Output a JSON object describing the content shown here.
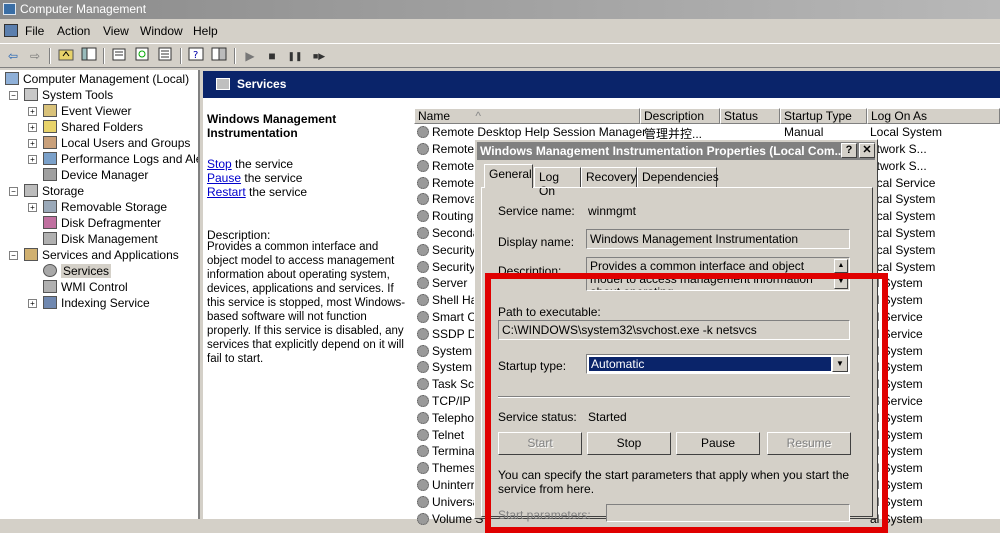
{
  "window": {
    "title": "Computer Management"
  },
  "menu": {
    "items": [
      "File",
      "Action",
      "View",
      "Window",
      "Help"
    ]
  },
  "toolbar": {
    "icons": [
      "back-arrow-icon",
      "forward-arrow-icon",
      "up-folder-icon",
      "show-hide-tree-icon",
      "properties-icon",
      "refresh-icon",
      "export-list-icon",
      "help-icon",
      "description-toggle-icon",
      "play-icon",
      "stop-icon",
      "pause-icon",
      "restart-icon"
    ],
    "glyphs": {
      "back": "⇦",
      "forward": "⇨",
      "play": "▶",
      "stop": "■",
      "pause": "❚❚",
      "restart": "■▶"
    }
  },
  "tree": {
    "root": "Computer Management (Local)",
    "system_tools": "System Tools",
    "event_viewer": "Event Viewer",
    "shared_folders": "Shared Folders",
    "local_users": "Local Users and Groups",
    "perf_logs": "Performance Logs and Alerts",
    "device_manager": "Device Manager",
    "storage": "Storage",
    "removable_storage": "Removable Storage",
    "disk_defrag": "Disk Defragmenter",
    "disk_mgmt": "Disk Management",
    "services_apps": "Services and Applications",
    "services": "Services",
    "wmi_control": "WMI Control",
    "indexing": "Indexing Service",
    "expand_minus": "−",
    "expand_plus": "+"
  },
  "services_header": {
    "title": "Services"
  },
  "description_pane": {
    "title": "Windows Management Instrumentation",
    "stop_link": "Stop",
    "stop_rest": " the service",
    "pause_link": "Pause",
    "pause_rest": " the service",
    "restart_link": "Restart",
    "restart_rest": " the service",
    "desc_label": "Description:",
    "desc_text": "Provides a common interface and object model to access management information about operating system, devices, applications and services. If this service is stopped, most Windows-based software will not function properly. If this service is disabled, any services that explicitly depend on it will fail to start."
  },
  "list": {
    "columns": [
      "Name",
      "Description",
      "Status",
      "Startup Type",
      "Log On As"
    ],
    "first_row": {
      "name": "Remote Desktop Help Session Manager",
      "description": "管理并控...",
      "status": "",
      "startup": "Manual",
      "logon": "Local System"
    },
    "names": [
      "Remote",
      "Remote",
      "Remote",
      "Remova",
      "Routing",
      "Seconda",
      "Security",
      "Security",
      "Server",
      "Shell Har",
      "Smart Ca",
      "SSDP Dis",
      "System I",
      "System I",
      "Task Sch",
      "TCP/IP N",
      "Telephor",
      "Telnet",
      "Terminal",
      "Themes",
      "Uninterr",
      "Universa",
      "Volume S"
    ],
    "logons": [
      "etwork S...",
      "etwork S...",
      "ocal Service",
      "ocal System",
      "ocal System",
      "ocal System",
      "ocal System",
      "ocal System",
      "al System",
      "al System",
      "al Service",
      "al Service",
      "al System",
      "al System",
      "al System",
      "al Service",
      "al System",
      "al System",
      "al System",
      "al System",
      "al System",
      "al System",
      "al System"
    ]
  },
  "dialog": {
    "title": "Windows Management Instrumentation Properties (Local Com...",
    "help_btn": "?",
    "close_btn": "✕",
    "tabs": [
      "General",
      "Log On",
      "Recovery",
      "Dependencies"
    ],
    "service_name_label": "Service name:",
    "service_name": "winmgmt",
    "display_name_label": "Display name:",
    "display_name": "Windows Management Instrumentation",
    "description_label": "Description:",
    "description": "Provides a common interface and object model to access management information about operating",
    "path_label": "Path to executable:",
    "path": "C:\\WINDOWS\\system32\\svchost.exe -k netsvcs",
    "startup_label": "Startup type:",
    "startup_value": "Automatic",
    "status_label": "Service status:",
    "status_value": "Started",
    "buttons": {
      "start": "Start",
      "stop": "Stop",
      "pause": "Pause",
      "resume": "Resume"
    },
    "note": "You can specify the start parameters that apply when you start the service from here.",
    "params_label": "Start parameters:",
    "scroll_up": "▲",
    "scroll_down": "▼",
    "combo_arrow": "▼"
  },
  "colors": {
    "highlight": "#0a246a",
    "annotation_red": "#e00000",
    "face": "#d4d0c8"
  }
}
